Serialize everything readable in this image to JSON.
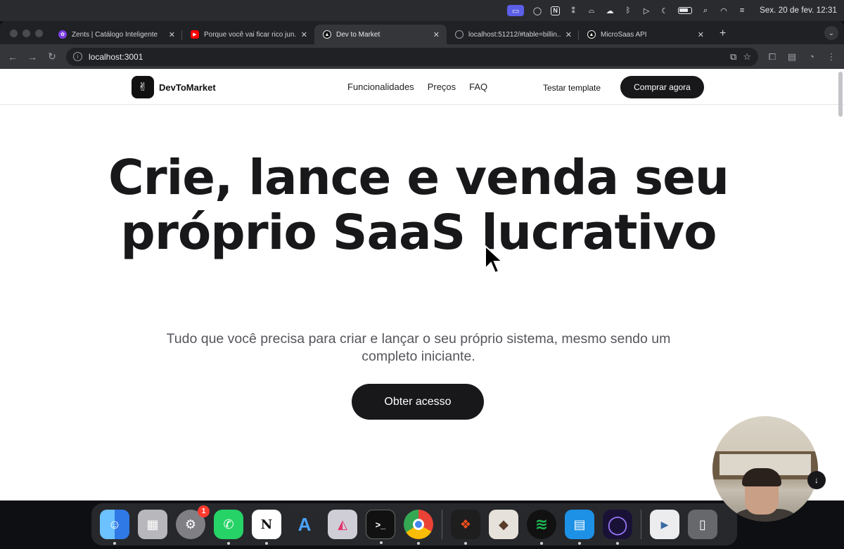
{
  "menubar": {
    "apple_icon": "apple-logo",
    "clock": "Sex. 20 de fev.  12:31"
  },
  "browser": {
    "tabs": [
      {
        "title": "Zents | Catálogo Inteligente",
        "favicon": "zents-icon",
        "color": "#7b3fe4"
      },
      {
        "title": "Porque você vai ficar rico jun...",
        "favicon": "youtube-icon",
        "color": "#ff0000"
      },
      {
        "title": "Dev to Market",
        "favicon": "triangle-icon",
        "color": "#111111"
      },
      {
        "title": "localhost:51212/#table=billin...",
        "favicon": "globe-icon",
        "color": "#9aa0a6"
      },
      {
        "title": "MicroSaas API",
        "favicon": "triangle-icon",
        "color": "#111111"
      }
    ],
    "url": "localhost:3001"
  },
  "site": {
    "brand": "DevToMarket",
    "nav": [
      "Funcionalidades",
      "Preços",
      "FAQ"
    ],
    "secondary_cta": "Testar template",
    "primary_cta": "Comprar agora",
    "hero_title": "Crie, lance e venda seu próprio SaaS lucrativo",
    "hero_subtitle": "Tudo que você precisa para criar e lançar o seu próprio sistema, mesmo sendo um completo iniciante.",
    "hero_cta": "Obter acesso"
  },
  "dock": {
    "apps": [
      {
        "name": "Finder",
        "color": "#3c8ef0",
        "glyph": "☺"
      },
      {
        "name": "Launchpad",
        "color": "#9e9ea3",
        "glyph": "▦"
      },
      {
        "name": "System Settings",
        "color": "#8b8b90",
        "glyph": "⚙",
        "badge": "1"
      },
      {
        "name": "WhatsApp",
        "color": "#25d366",
        "glyph": "✆"
      },
      {
        "name": "Notion",
        "color": "#ffffff",
        "glyph": "N"
      },
      {
        "name": "Arc",
        "color": "#2b2d31",
        "glyph": "A"
      },
      {
        "name": "Affinity",
        "color": "#c9c7d0",
        "glyph": "◭"
      },
      {
        "name": "Terminal",
        "color": "#1c1c1e",
        "glyph": ">_"
      },
      {
        "name": "Chrome",
        "color": "#e8eaed",
        "glyph": "◉"
      },
      {
        "name": "Figma",
        "color": "#1e1e1e",
        "glyph": "❖"
      },
      {
        "name": "Sequel Ace",
        "color": "#e6e1da",
        "glyph": "◆"
      },
      {
        "name": "Spotify",
        "color": "#1db954",
        "glyph": "≋"
      },
      {
        "name": "Docker",
        "color": "#1d91e6",
        "glyph": "▤"
      },
      {
        "name": "Screen Recorder",
        "color": "#2a1e4d",
        "glyph": "◯"
      },
      {
        "name": "MP4 file",
        "color": "#e9e9ec",
        "glyph": "▶"
      },
      {
        "name": "Trash",
        "color": "#a7a9ad",
        "glyph": "🗑"
      }
    ]
  }
}
